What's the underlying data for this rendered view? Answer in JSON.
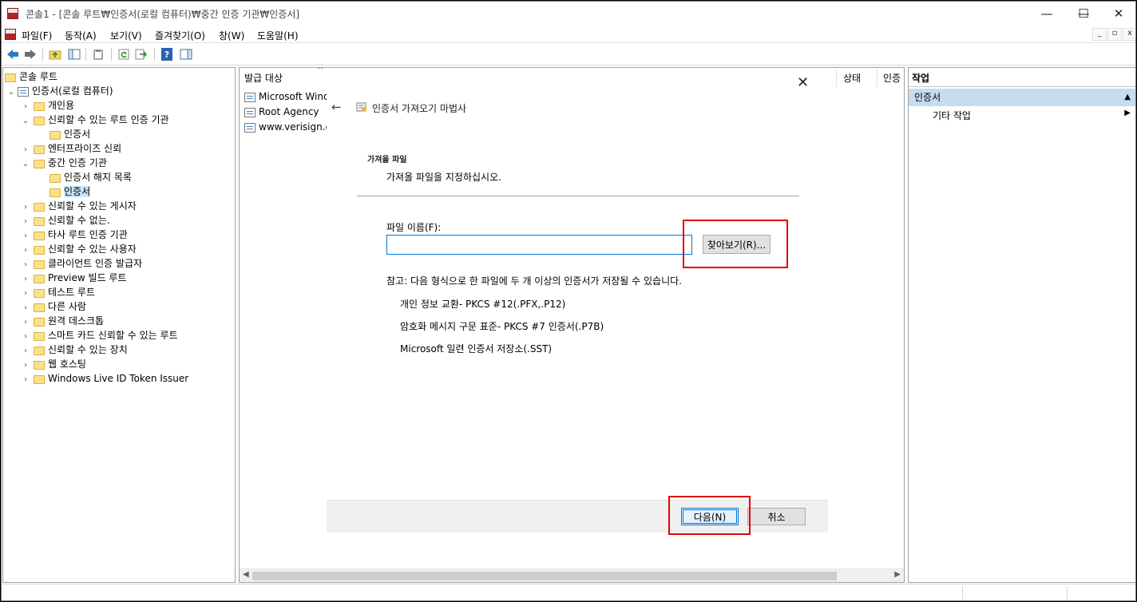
{
  "window": {
    "title": "콘솔1 - [콘솔 루트₩인증서(로컬 컴퓨터)₩중간 인증 기관₩인증서]",
    "minimize_glyph": "—",
    "maximize_glyph": "☐",
    "close_glyph": "✕"
  },
  "menu": {
    "items": [
      "파일(F)",
      "동작(A)",
      "보기(V)",
      "즐겨찾기(O)",
      "창(W)",
      "도움말(H)"
    ],
    "mdi_min": "_",
    "mdi_restore": "▫",
    "mdi_close": "x"
  },
  "toolbar": {
    "icons": [
      "back-arrow-icon",
      "forward-arrow-icon",
      "up-folder-icon",
      "show-hide-tree-icon",
      "clipboard-icon",
      "refresh-icon",
      "export-list-icon",
      "help-icon",
      "show-hide-action-icon"
    ]
  },
  "tree": {
    "root": "콘솔 루트",
    "computer": "인증서(로컬 컴퓨터)",
    "items": [
      {
        "label": "개인용",
        "level": 1,
        "expanded": false
      },
      {
        "label": "신뢰할 수 있는 루트 인증 기관",
        "level": 1,
        "expanded": true
      },
      {
        "label": "인증서",
        "level": 2
      },
      {
        "label": "엔터프라이즈 신뢰",
        "level": 1,
        "expanded": false
      },
      {
        "label": "중간 인증 기관",
        "level": 1,
        "expanded": true
      },
      {
        "label": "인증서 해지 목록",
        "level": 2
      },
      {
        "label": "인증서",
        "level": 2,
        "selected": true
      },
      {
        "label": "신뢰할 수 있는 게시자",
        "level": 1,
        "expanded": false
      },
      {
        "label": "신뢰할 수 없는.",
        "level": 1,
        "expanded": false
      },
      {
        "label": "타사 루트 인증 기관",
        "level": 1,
        "expanded": false
      },
      {
        "label": "신뢰할 수 있는 사용자",
        "level": 1,
        "expanded": false
      },
      {
        "label": "클라이언트 인증 발급자",
        "level": 1,
        "expanded": false
      },
      {
        "label": "Preview 빌드 루트",
        "level": 1,
        "expanded": false
      },
      {
        "label": "테스트 루트",
        "level": 1,
        "expanded": false
      },
      {
        "label": "다른 사람",
        "level": 1,
        "expanded": false
      },
      {
        "label": "원격 데스크톱",
        "level": 1,
        "expanded": false
      },
      {
        "label": "스마트 카드 신뢰할 수 있는 루트",
        "level": 1,
        "expanded": false
      },
      {
        "label": "신뢰할 수 있는 장치",
        "level": 1,
        "expanded": false
      },
      {
        "label": "웹 호스팅",
        "level": 1,
        "expanded": false
      },
      {
        "label": "Windows Live ID Token Issuer",
        "level": 1,
        "expanded": false
      }
    ]
  },
  "list": {
    "columns": [
      "발급 대상",
      "상태",
      "인증"
    ],
    "rows": [
      "Microsoft Windo",
      "Root Agency",
      "www.verisign.cc"
    ]
  },
  "actions": {
    "title": "작업",
    "section": "인증서",
    "item": "기타 작업"
  },
  "wizard": {
    "title": "인증서 가져오기 마법사",
    "heading": "가져올 파일",
    "subheading": "가져올 파일을 지정하십시오.",
    "file_label": "파일 이름(F):",
    "file_value": "",
    "browse": "찾아보기(R)...",
    "note": "참고: 다음 형식으로 한 파일에 두 개 이상의 인증서가 저장될 수 있습니다.",
    "formats": [
      "개인 정보 교환- PKCS #12(.PFX,.P12)",
      "암호화 메시지 구문 표준- PKCS #7 인증서(.P7B)",
      "Microsoft 일련 인증서 저장소(.SST)"
    ],
    "next": "다음(N)",
    "cancel": "취소"
  },
  "highlight_color": "#e30000",
  "accent_color": "#0078d7"
}
